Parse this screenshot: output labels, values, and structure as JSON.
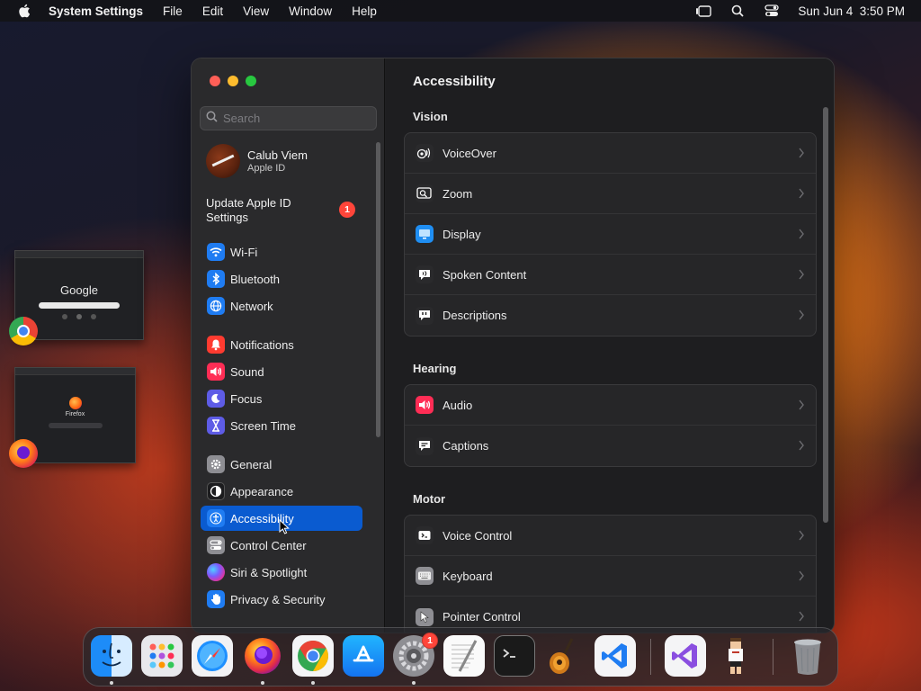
{
  "menubar": {
    "app_name": "System Settings",
    "items": [
      "File",
      "Edit",
      "View",
      "Window",
      "Help"
    ],
    "clock": "Sun Jun 4  3:50 PM"
  },
  "sidebar": {
    "search_placeholder": "Search",
    "account": {
      "name": "Calub Viem",
      "subtitle": "Apple ID"
    },
    "update": {
      "label": "Update Apple ID Settings",
      "badge": "1"
    },
    "items": [
      {
        "label": "Wi-Fi",
        "icon": "wifi-icon",
        "color": "#1f7cf2"
      },
      {
        "label": "Bluetooth",
        "icon": "bluetooth-icon",
        "color": "#1f7cf2"
      },
      {
        "label": "Network",
        "icon": "globe-icon",
        "color": "#1f7cf2"
      },
      {
        "label": "Notifications",
        "icon": "bell-icon",
        "color": "#ff3b30"
      },
      {
        "label": "Sound",
        "icon": "speaker-icon",
        "color": "#ff2d55"
      },
      {
        "label": "Focus",
        "icon": "moon-icon",
        "color": "#5e5ce6"
      },
      {
        "label": "Screen Time",
        "icon": "hourglass-icon",
        "color": "#5e5ce6"
      },
      {
        "label": "General",
        "icon": "gear-icon",
        "color": "#8e8e93"
      },
      {
        "label": "Appearance",
        "icon": "appearance-icon",
        "color": "#1c1c1e"
      },
      {
        "label": "Accessibility",
        "icon": "accessibility-icon",
        "color": "#1f7cf2",
        "selected": true
      },
      {
        "label": "Control Center",
        "icon": "control-center-icon",
        "color": "#8e8e93"
      },
      {
        "label": "Siri & Spotlight",
        "icon": "siri-icon",
        "color": "#b03ac0"
      },
      {
        "label": "Privacy & Security",
        "icon": "hand-icon",
        "color": "#1f7cf2"
      }
    ]
  },
  "main": {
    "title": "Accessibility",
    "sections": [
      {
        "title": "Vision",
        "rows": [
          {
            "label": "VoiceOver",
            "icon": "voiceover-icon"
          },
          {
            "label": "Zoom",
            "icon": "zoom-icon"
          },
          {
            "label": "Display",
            "icon": "display-icon"
          },
          {
            "label": "Spoken Content",
            "icon": "spoken-content-icon"
          },
          {
            "label": "Descriptions",
            "icon": "descriptions-icon"
          }
        ]
      },
      {
        "title": "Hearing",
        "rows": [
          {
            "label": "Audio",
            "icon": "audio-icon"
          },
          {
            "label": "Captions",
            "icon": "captions-icon"
          }
        ]
      },
      {
        "title": "Motor",
        "rows": [
          {
            "label": "Voice Control",
            "icon": "voice-control-icon"
          },
          {
            "label": "Keyboard",
            "icon": "keyboard-icon"
          },
          {
            "label": "Pointer Control",
            "icon": "pointer-icon"
          }
        ]
      }
    ]
  },
  "stage_manager": {
    "chrome_thumb_text": "Google",
    "firefox_thumb_text": "Firefox"
  },
  "dock": {
    "apps": [
      "Finder",
      "Launchpad",
      "Safari",
      "Firefox",
      "Chrome",
      "App Store",
      "System Settings",
      "TextEdit",
      "Terminal",
      "GarageBand",
      "Visual Studio Code",
      "Visual Studio",
      "Game",
      "Trash"
    ],
    "settings_badge": "1"
  }
}
